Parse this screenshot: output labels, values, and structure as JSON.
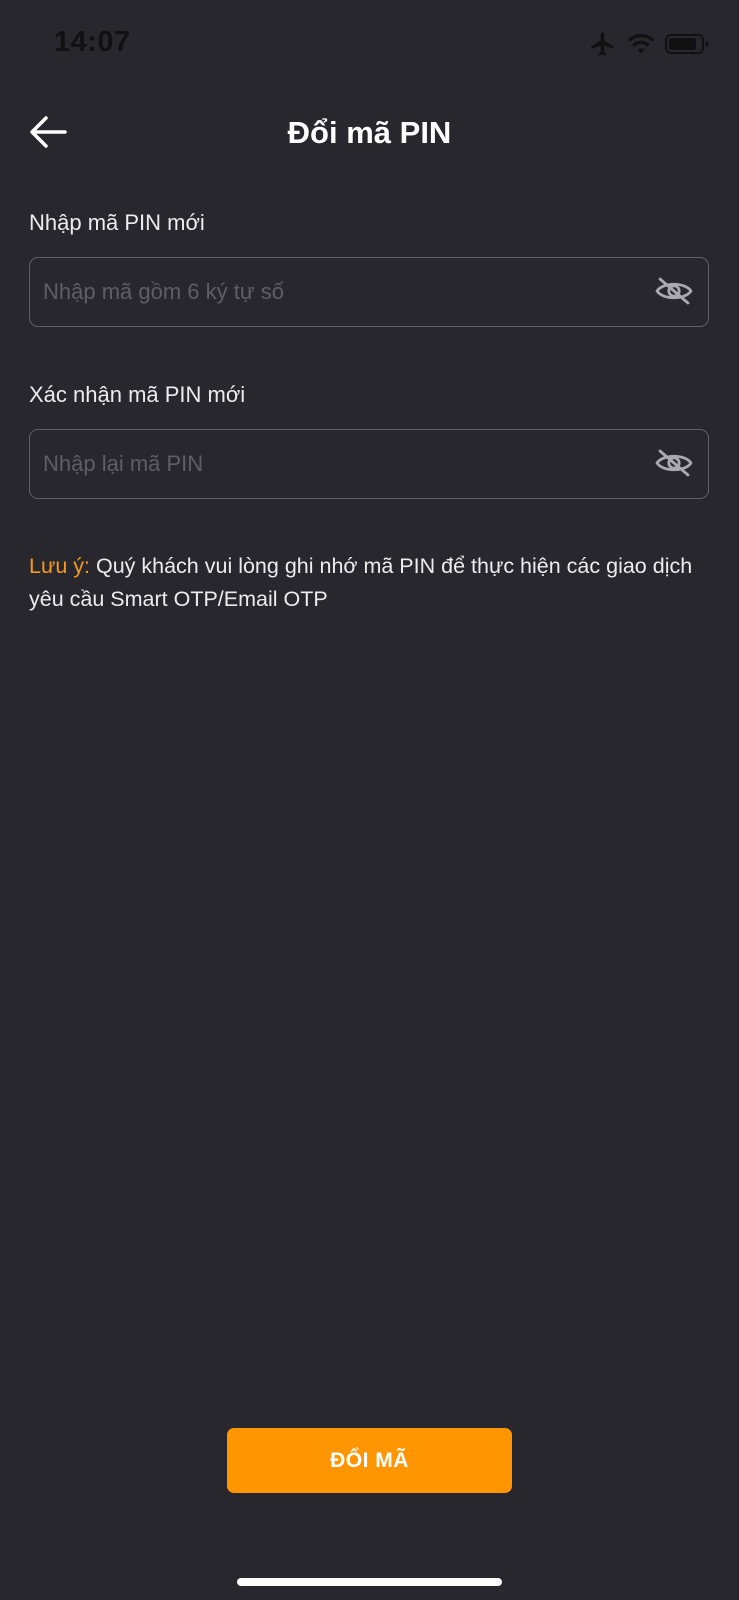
{
  "status_bar": {
    "time": "14:07",
    "icons": [
      "airplane-icon",
      "wifi-icon",
      "battery-icon"
    ]
  },
  "header": {
    "title": "Đổi mã PIN",
    "back_icon": "arrow-left-icon"
  },
  "form": {
    "new_pin": {
      "label": "Nhập mã PIN mới",
      "placeholder": "Nhập mã gồm 6 ký tự số",
      "value": "",
      "toggle_icon": "eye-off-icon"
    },
    "confirm_pin": {
      "label": "Xác nhận mã PIN mới",
      "placeholder": "Nhập lại mã PIN",
      "value": "",
      "toggle_icon": "eye-off-icon"
    }
  },
  "note": {
    "prefix": "Lưu ý:",
    "text": " Quý khách vui lòng ghi nhớ mã PIN để thực hiện các giao dịch yêu cầu Smart OTP/Email OTP"
  },
  "submit": {
    "label": "ĐỔI MÃ"
  },
  "colors": {
    "background": "#28272e",
    "accent": "#ff9500",
    "note_prefix": "#f59a1c",
    "input_border": "#5f5f66",
    "placeholder": "#5e5e66"
  }
}
